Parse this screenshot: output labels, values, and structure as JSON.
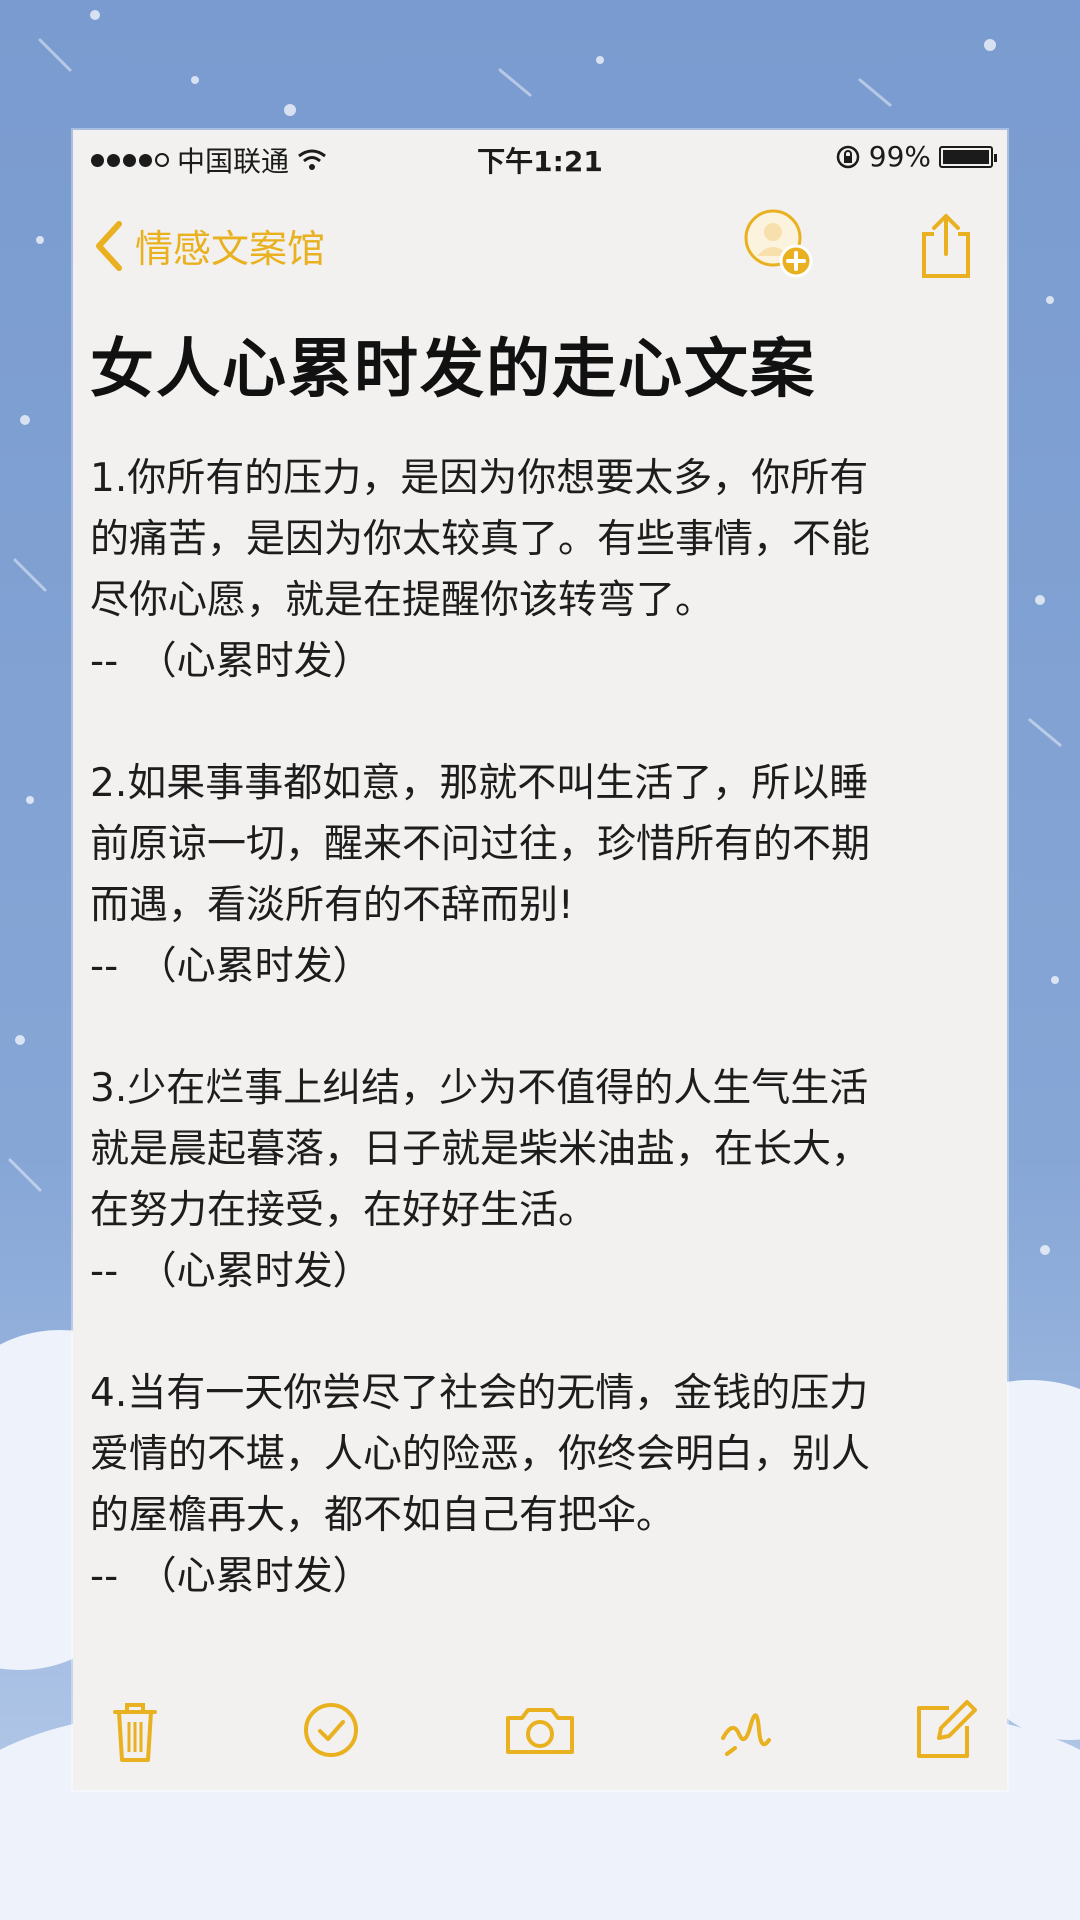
{
  "status_bar": {
    "carrier": "中国联通",
    "time": "下午1:21",
    "battery": "99%",
    "battery_level": 0.99
  },
  "nav": {
    "back_label": "情感文案馆"
  },
  "note": {
    "title": "女人心累时发的走心文案",
    "paragraphs": [
      {
        "lines": [
          "1.你所有的压力，是因为你想要太多，你所有",
          "的痛苦，是因为你太较真了。有些事情，不能",
          "尽你心愿，就是在提醒你该转弯了。"
        ],
        "sign": "--　（心累时发）"
      },
      {
        "lines": [
          "2.如果事事都如意，那就不叫生活了，所以睡",
          "前原谅一切，醒来不问过往，珍惜所有的不期",
          "而遇，看淡所有的不辞而别!"
        ],
        "sign": "--　（心累时发）"
      },
      {
        "lines": [
          "3.少在烂事上纠结，少为不值得的人生气生活",
          "就是晨起暮落，日子就是柴米油盐，在长大，",
          "在努力在接受，在好好生活。"
        ],
        "sign": "--　（心累时发）"
      },
      {
        "lines": [
          "4.当有一天你尝尽了社会的无情，金钱的压力",
          "爱情的不堪，人心的险恶，你终会明白，别人",
          "的屋檐再大，都不如自己有把伞。"
        ],
        "sign": "--　（心累时发）"
      }
    ]
  },
  "colors": {
    "accent": "#e9b120",
    "text": "#1d1d1d",
    "paper": "#f2f1ef",
    "background": "#7e9fd0"
  },
  "icons": {
    "back": "chevron-left-icon",
    "avatar": "add-contact-icon",
    "share": "share-icon",
    "toolbar": [
      "trash-icon",
      "checkmark-icon",
      "camera-icon",
      "sketch-icon",
      "compose-icon"
    ]
  }
}
